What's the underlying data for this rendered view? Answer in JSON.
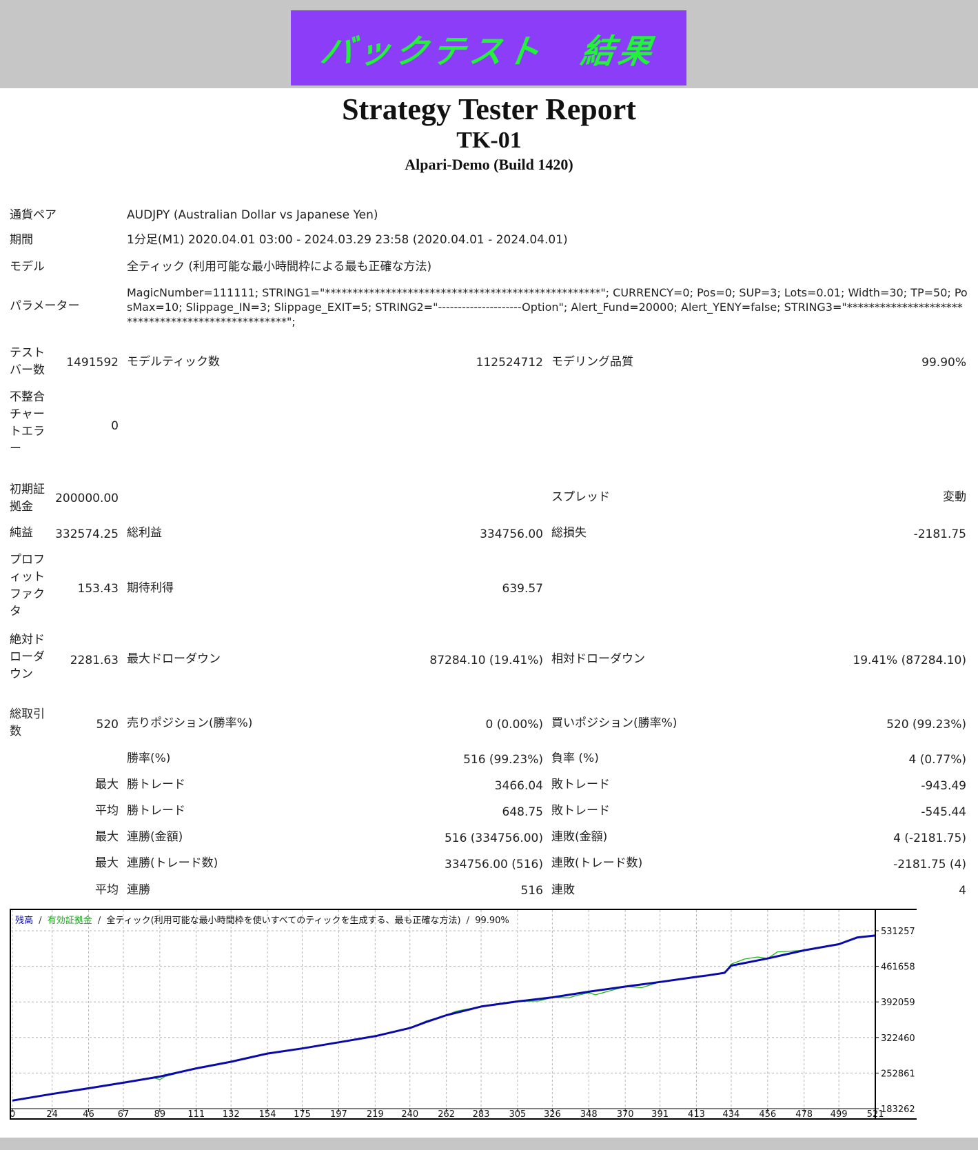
{
  "banner": {
    "text": "バックテスト　結果",
    "bg_color": "#8b3df8",
    "text_color": "#22f23a"
  },
  "report": {
    "title": "Strategy Tester Report",
    "ea_name": "TK-01",
    "server": "Alpari-Demo (Build 1420)"
  },
  "info": {
    "symbol_label": "通貨ペア",
    "symbol_value": "AUDJPY (Australian Dollar vs Japanese Yen)",
    "period_label": "期間",
    "period_value": "1分足(M1) 2020.04.01 03:00 - 2024.03.29 23:58 (2020.04.01 - 2024.04.01)",
    "model_label": "モデル",
    "model_value": "全ティック (利用可能な最小時間枠による最も正確な方法)",
    "params_label": "パラメーター",
    "params_value": "MagicNumber=111111; STRING1=\"**************************************************\"; CURRENCY=0; Pos=0; SUP=3; Lots=0.01; Width=30; TP=50; PosMax=10; Slippage_IN=3; Slippage_EXIT=5; STRING2=\"---------------------Option\"; Alert_Fund=20000; Alert_YENY=false; STRING3=\"**************************************************\";"
  },
  "stats": {
    "bars_label": "テストバー数",
    "bars_value": "1491592",
    "ticks_label": "モデルティック数",
    "ticks_value": "112524712",
    "quality_label": "モデリング品質",
    "quality_value": "99.90%",
    "mismatch_label": "不整合チャートエラー",
    "mismatch_value": "0",
    "deposit_label": "初期証拠金",
    "deposit_value": "200000.00",
    "spread_label": "スプレッド",
    "spread_value": "変動",
    "net_label": "純益",
    "net_value": "332574.25",
    "gross_profit_label": "総利益",
    "gross_profit_value": "334756.00",
    "gross_loss_label": "総損失",
    "gross_loss_value": "-2181.75",
    "pf_label": "プロフィットファクタ",
    "pf_value": "153.43",
    "expected_label": "期待利得",
    "expected_value": "639.57",
    "abs_dd_label": "絶対ドローダウン",
    "abs_dd_value": "2281.63",
    "max_dd_label": "最大ドローダウン",
    "max_dd_value": "87284.10 (19.41%)",
    "rel_dd_label": "相対ドローダウン",
    "rel_dd_value": "19.41% (87284.10)",
    "trades_label": "総取引数",
    "trades_value": "520",
    "short_label": "売りポジション(勝率%)",
    "short_value": "0 (0.00%)",
    "long_label": "買いポジション(勝率%)",
    "long_value": "520 (99.23%)",
    "win_label": "勝率(%)",
    "win_value": "516 (99.23%)",
    "loss_label": "負率 (%)",
    "loss_value": "4 (0.77%)",
    "rows": [
      {
        "prefix": "最大",
        "l1": "勝トレード",
        "v1": "3466.04",
        "l2": "敗トレード",
        "v2": "-943.49"
      },
      {
        "prefix": "平均",
        "l1": "勝トレード",
        "v1": "648.75",
        "l2": "敗トレード",
        "v2": "-545.44"
      },
      {
        "prefix": "最大",
        "l1": "連勝(金額)",
        "v1": "516 (334756.00)",
        "l2": "連敗(金額)",
        "v2": "4 (-2181.75)"
      },
      {
        "prefix": "最大",
        "l1": "連勝(トレード数)",
        "v1": "334756.00 (516)",
        "l2": "連敗(トレード数)",
        "v2": "-2181.75 (4)"
      },
      {
        "prefix": "平均",
        "l1": "連勝",
        "v1": "516",
        "l2": "連敗",
        "v2": "4"
      }
    ]
  },
  "chart_data": {
    "type": "line",
    "legend": {
      "balance": "残高",
      "equity": "有効証拠金",
      "model": "全ティック(利用可能な最小時間枠を使いすべてのティックを生成する、最も正確な方法)",
      "quality": "99.90%",
      "sep": "/"
    },
    "x_ticks": [
      "0",
      "24",
      "46",
      "67",
      "89",
      "111",
      "132",
      "154",
      "175",
      "197",
      "219",
      "240",
      "262",
      "283",
      "305",
      "326",
      "348",
      "370",
      "391",
      "413",
      "434",
      "456",
      "478",
      "499",
      "521"
    ],
    "y_ticks": [
      "531257",
      "461658",
      "392059",
      "322460",
      "252861",
      "183262"
    ],
    "xlim": [
      0,
      521
    ],
    "ylim": [
      183262,
      531257
    ],
    "grid": true,
    "colors": {
      "balance": "#0a0aa8",
      "equity": "#22b322",
      "grid": "#b4b4b4"
    },
    "series": [
      {
        "name": "残高",
        "x": [
          0,
          24,
          46,
          67,
          89,
          111,
          132,
          154,
          175,
          197,
          219,
          240,
          250,
          262,
          283,
          305,
          326,
          348,
          370,
          391,
          413,
          420,
          430,
          434,
          456,
          478,
          499,
          510,
          521
        ],
        "y": [
          199000,
          212000,
          223000,
          234000,
          246000,
          262000,
          275000,
          291000,
          301000,
          313000,
          325000,
          341000,
          353000,
          366000,
          383000,
          393000,
          401000,
          412000,
          422000,
          431000,
          441000,
          444000,
          449000,
          463000,
          477000,
          493000,
          505000,
          518000,
          522000
        ]
      },
      {
        "name": "有効証拠金",
        "x": [
          0,
          24,
          46,
          67,
          85,
          89,
          92,
          111,
          132,
          154,
          175,
          197,
          219,
          230,
          240,
          245,
          250,
          262,
          268,
          283,
          305,
          318,
          326,
          336,
          340,
          348,
          352,
          370,
          380,
          391,
          413,
          420,
          430,
          434,
          442,
          450,
          456,
          462,
          478,
          482,
          499,
          510,
          521
        ],
        "y": [
          199000,
          212000,
          223000,
          234000,
          244000,
          240000,
          246000,
          262000,
          275000,
          291000,
          301000,
          313000,
          325000,
          333000,
          341000,
          348000,
          355000,
          366000,
          374000,
          383000,
          393000,
          394000,
          401000,
          400000,
          404000,
          410000,
          406000,
          422000,
          420000,
          431000,
          441000,
          444000,
          449000,
          466000,
          476000,
          480000,
          477000,
          490000,
          493000,
          496000,
          505000,
          518000,
          522000
        ]
      }
    ]
  }
}
